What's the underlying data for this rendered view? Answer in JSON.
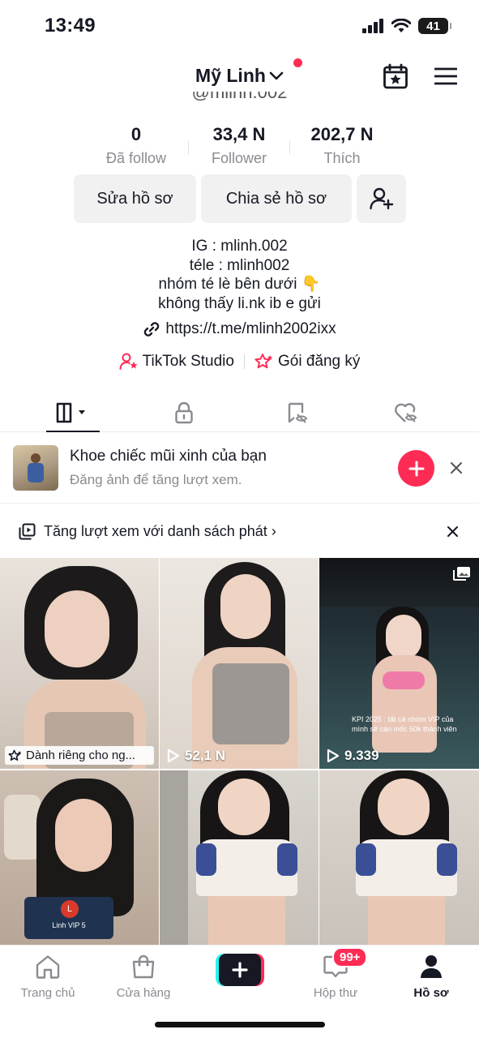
{
  "status": {
    "time": "13:49",
    "battery": "41"
  },
  "header": {
    "username": "Mỹ Linh",
    "handle": "@mlinh.002"
  },
  "stats": [
    {
      "value": "0",
      "label": "Đã follow"
    },
    {
      "value": "33,4 N",
      "label": "Follower"
    },
    {
      "value": "202,7 N",
      "label": "Thích"
    }
  ],
  "actions": {
    "edit": "Sửa hồ sơ",
    "share": "Chia sẻ hồ sơ"
  },
  "bio": {
    "lines": [
      "IG : mlinh.002",
      "téle : mlinh002",
      "nhóm té lè bên dưới 👇",
      "không thấy li.nk ib e gửi"
    ],
    "link": "https://t.me/mlinh2002ixx"
  },
  "tools": {
    "studio": "TikTok Studio",
    "subscription": "Gói đăng ký"
  },
  "promo": {
    "title": "Khoe chiếc mũi xinh của bạn",
    "subtitle": "Đăng ảnh để tăng lượt xem."
  },
  "playlist": {
    "text": "Tăng lượt xem với danh sách phát",
    "chevron": "›"
  },
  "videos": [
    {
      "label": "Dành riêng cho ng..."
    },
    {
      "views": "52,1 N"
    },
    {
      "views": "9.339",
      "caption": "KPI 2025 : tất cả nhóm VIP của mình sẽ cán mốc 50k thành viên"
    },
    {
      "chat_avatar": "L",
      "chat_name": "Linh VIP 5"
    },
    {},
    {}
  ],
  "nav": {
    "home": "Trang chủ",
    "shop": "Cửa hàng",
    "inbox": "Hộp thư",
    "inbox_badge": "99+",
    "profile": "Hồ sơ"
  }
}
